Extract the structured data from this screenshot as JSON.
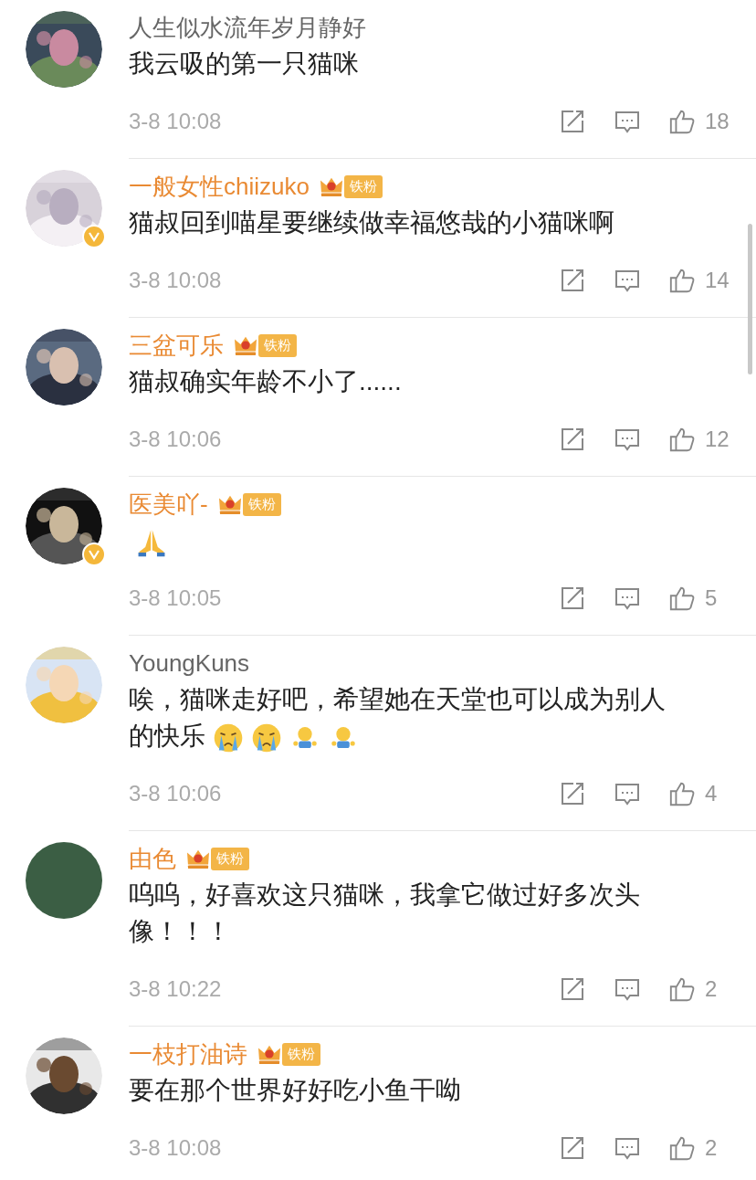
{
  "comments": [
    {
      "avatar": {
        "kind": "picture"
      },
      "verified": false,
      "name": "人生似水流年岁月静好",
      "member": false,
      "lines": [
        "我云吸的第一只猫咪"
      ],
      "time": "3-8 10:08",
      "likes": "18"
    },
    {
      "avatar": {
        "kind": "picture"
      },
      "verified": true,
      "name": "一般女性chiizuko",
      "member": true,
      "fan_badge": "铁粉",
      "lines": [
        "猫叔回到喵星要继续做幸福悠哉的小猫咪啊"
      ],
      "time": "3-8 10:08",
      "likes": "14"
    },
    {
      "avatar": {
        "kind": "picture"
      },
      "verified": false,
      "name": "三盆可乐",
      "member": true,
      "fan_badge": "铁粉",
      "lines": [
        "猫叔确实年龄不小了......"
      ],
      "time": "3-8 10:06",
      "likes": "12"
    },
    {
      "avatar": {
        "kind": "picture"
      },
      "verified": true,
      "name": "医美吖-",
      "member": true,
      "fan_badge": "铁粉",
      "emojis": [
        {
          "kind": "pray"
        }
      ],
      "time": "3-8 10:05",
      "likes": "5"
    },
    {
      "avatar": {
        "kind": "picture"
      },
      "verified": false,
      "name": "YoungKuns",
      "member": false,
      "lines": [
        "唉，猫咪走好吧，希望她在天堂也可以成为别人",
        "的快乐"
      ],
      "emojis": [
        {
          "kind": "cry"
        },
        {
          "kind": "cry"
        },
        {
          "kind": "figure"
        },
        {
          "kind": "figure"
        }
      ],
      "time": "3-8 10:06",
      "likes": "4"
    },
    {
      "avatar": {
        "kind": "plain",
        "color": "#3b5e44"
      },
      "verified": false,
      "name": "由色",
      "member": true,
      "fan_badge": "铁粉",
      "lines": [
        "呜呜，好喜欢这只猫咪，我拿它做过好多次头",
        "像！！！"
      ],
      "time": "3-8 10:22",
      "likes": "2"
    },
    {
      "avatar": {
        "kind": "picture"
      },
      "verified": false,
      "name": "一枝打油诗",
      "member": true,
      "fan_badge": "铁粉",
      "lines": [
        "要在那个世界好好吃小鱼干呦"
      ],
      "time": "3-8 10:08",
      "likes": "2"
    }
  ]
}
